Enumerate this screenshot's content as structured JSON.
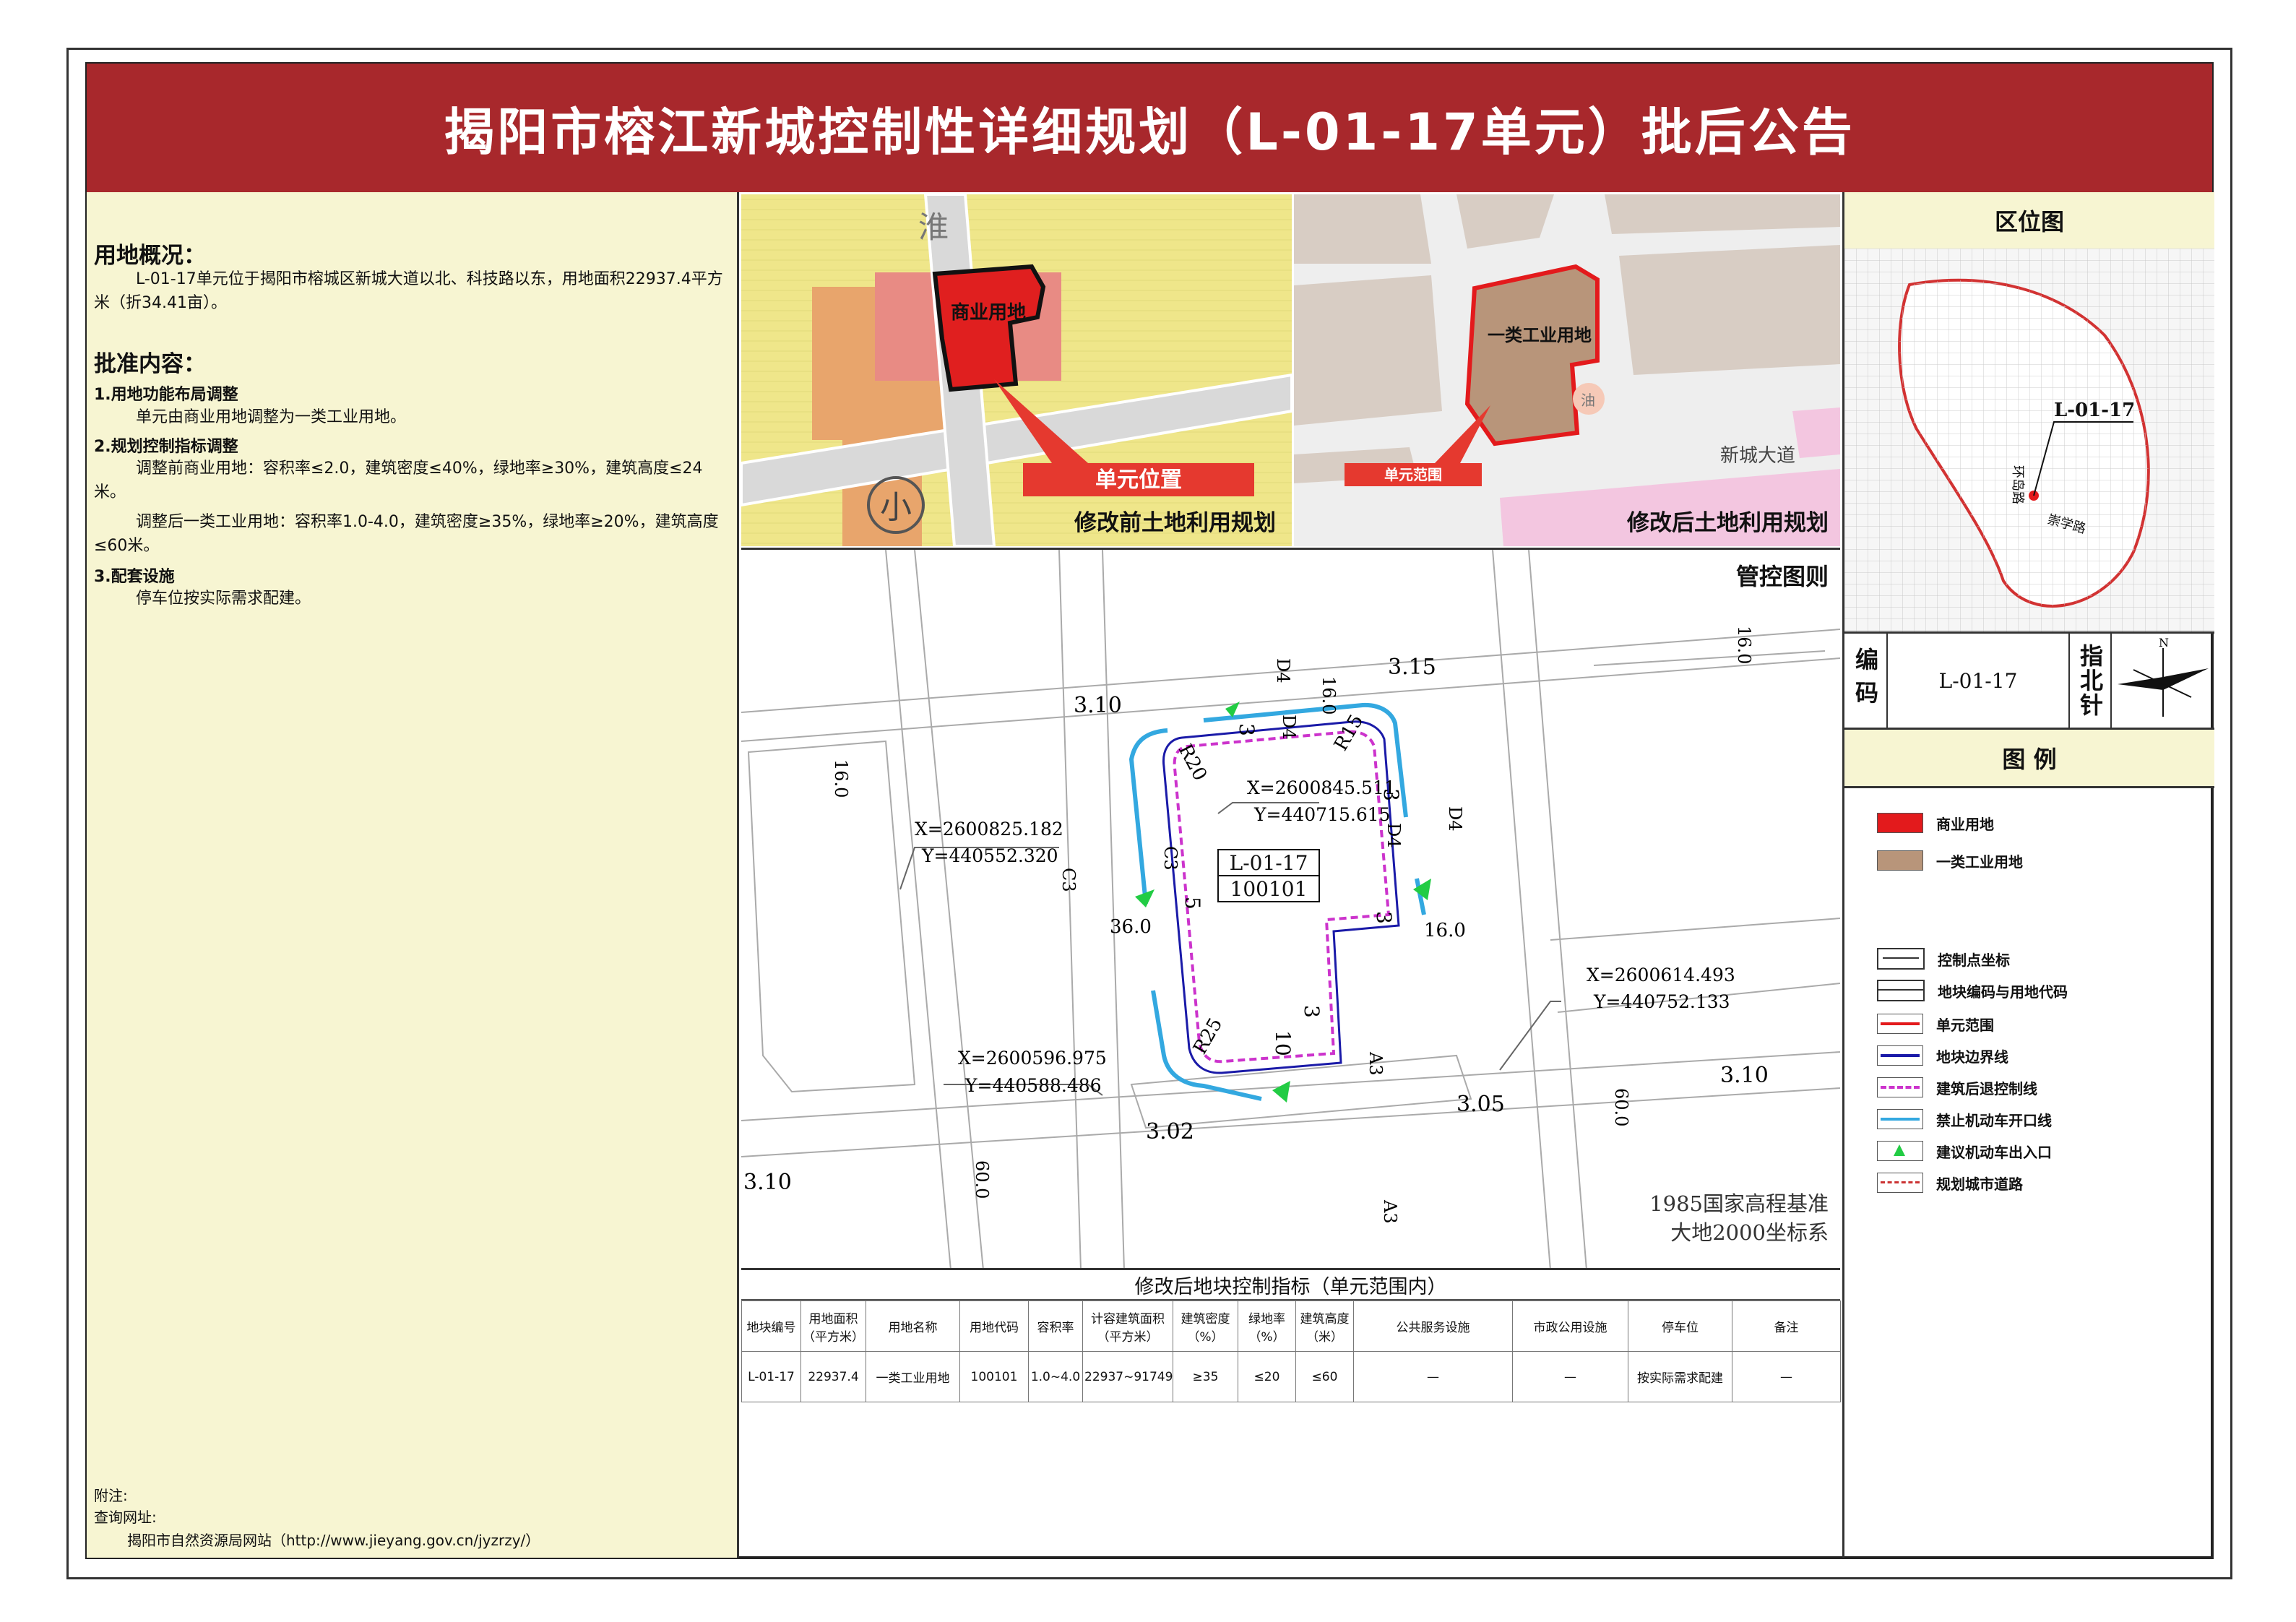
{
  "title": "揭阳市榕江新城控制性详细规划（L-01-17单元）批后公告",
  "overview": {
    "heading": "用地概况：",
    "text": "L-01-17单元位于揭阳市榕城区新城大道以北、科技路以东，用地面积22937.4平方米（折34.41亩）。"
  },
  "approval": {
    "heading": "批准内容：",
    "item1_title": "1.用地功能布局调整",
    "item1_text": "单元由商业用地调整为一类工业用地。",
    "item2_title": "2.规划控制指标调整",
    "item2_before": "调整前商业用地：容积率≤2.0，建筑密度≤40%，绿地率≥30%，建筑高度≤24米。",
    "item2_after": "调整后一类工业用地：容积率1.0-4.0，建筑密度≥35%，绿地率≥20%，建筑高度≤60米。",
    "item3_title": "3.配套设施",
    "item3_text": "停车位按实际需求配建。"
  },
  "footer": {
    "note": "附注:",
    "query": "查询网址:",
    "site": "揭阳市自然资源局网站（http://www.jieyang.gov.cn/jyzrzy/）"
  },
  "map_before": {
    "caption": "修改前土地利用规划",
    "badge": "单元位置",
    "land_label": "商业用地",
    "road_char": "淮",
    "school_char": "小"
  },
  "map_after": {
    "caption": "修改后土地利用规划",
    "badge": "单元范围",
    "land_label": "一类工业用地",
    "road_label": "新城大道",
    "station_char": "油"
  },
  "control_map": {
    "caption": "管控图则",
    "unit_code": "L-01-17",
    "land_code": "100101",
    "coords": [
      {
        "x": "X=2600825.182",
        "y": "Y=440552.320"
      },
      {
        "x": "X=2600845.511",
        "y": "Y=440715.615"
      },
      {
        "x": "X=2600614.493",
        "y": "Y=440752.133"
      },
      {
        "x": "X=2600596.975",
        "y": "Y=440588.486"
      }
    ],
    "elevations": [
      "3.15",
      "3.10",
      "3.10",
      "3.05",
      "3.02",
      "3.10"
    ],
    "road_widths": [
      "16.0",
      "16.0",
      "36.0",
      "16.0",
      "60.0",
      "60.0",
      "16.0"
    ],
    "radii": [
      "R20",
      "R15",
      "R25"
    ],
    "road_classes": [
      "D4",
      "D4",
      "D4",
      "D4",
      "C3",
      "C3",
      "A3",
      "A3"
    ],
    "setbacks": [
      "3",
      "3",
      "3",
      "3",
      "5",
      "10"
    ],
    "datum1": "1985国家高程基准",
    "datum2": "大地2000坐标系"
  },
  "table": {
    "title": "修改后地块控制指标（单元范围内）",
    "headers": [
      "地块编号",
      "用地面积（平方米）",
      "用地名称",
      "用地代码",
      "容积率",
      "计容建筑面积（平方米）",
      "建筑密度（%）",
      "绿地率（%）",
      "建筑高度（米）",
      "公共服务设施",
      "市政公用设施",
      "停车位",
      "备注"
    ],
    "row": [
      "L-01-17",
      "22937.4",
      "一类工业用地",
      "100101",
      "1.0~4.0",
      "22937~91749",
      "≥35",
      "≤20",
      "≤60",
      "—",
      "—",
      "按实际需求配建",
      "—"
    ]
  },
  "location_map": {
    "heading": "区位图",
    "unit_label": "L-01-17",
    "road_a": "环岛路",
    "road_b": "崇学路"
  },
  "code_box": {
    "label": "编码",
    "value": "L-01-17",
    "north_label": "指北针",
    "north_letter": "N"
  },
  "legend": {
    "heading": "图 例",
    "items": [
      {
        "label": "商业用地",
        "color": "#e31a1c"
      },
      {
        "label": "一类工业用地",
        "color": "#b8957a"
      },
      {
        "label": "控制点坐标"
      },
      {
        "label": "地块编码与用地代码"
      },
      {
        "label": "单元范围",
        "color": "#e31a1c"
      },
      {
        "label": "地块边界线",
        "color": "#1a1aa8"
      },
      {
        "label": "建筑后退控制线",
        "color": "#cc33cc"
      },
      {
        "label": "禁止机动车开口线",
        "color": "#33a8e0"
      },
      {
        "label": "建议机动车出入口",
        "color": "#22cc44"
      },
      {
        "label": "规划城市道路",
        "color": "#cc3333"
      }
    ]
  }
}
